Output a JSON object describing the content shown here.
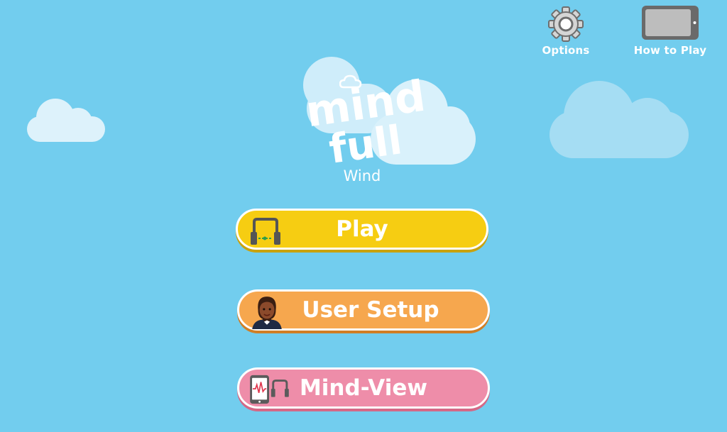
{
  "header": {
    "options_label": "Options",
    "how_to_play_label": "How to Play"
  },
  "logo": {
    "line1": "mind",
    "line2": "full",
    "subtitle": "Wind"
  },
  "menu": {
    "play_label": "Play",
    "user_setup_label": "User Setup",
    "mind_view_label": "Mind-View"
  },
  "colors": {
    "sky": "#72CDEE",
    "play": "#F6CD12",
    "user_setup": "#F6A74E",
    "mind_view": "#EE8DA9"
  },
  "icons": [
    "gear-icon",
    "tablet-icon",
    "headset-icon",
    "avatar-icon",
    "tablet-headset-icon"
  ]
}
